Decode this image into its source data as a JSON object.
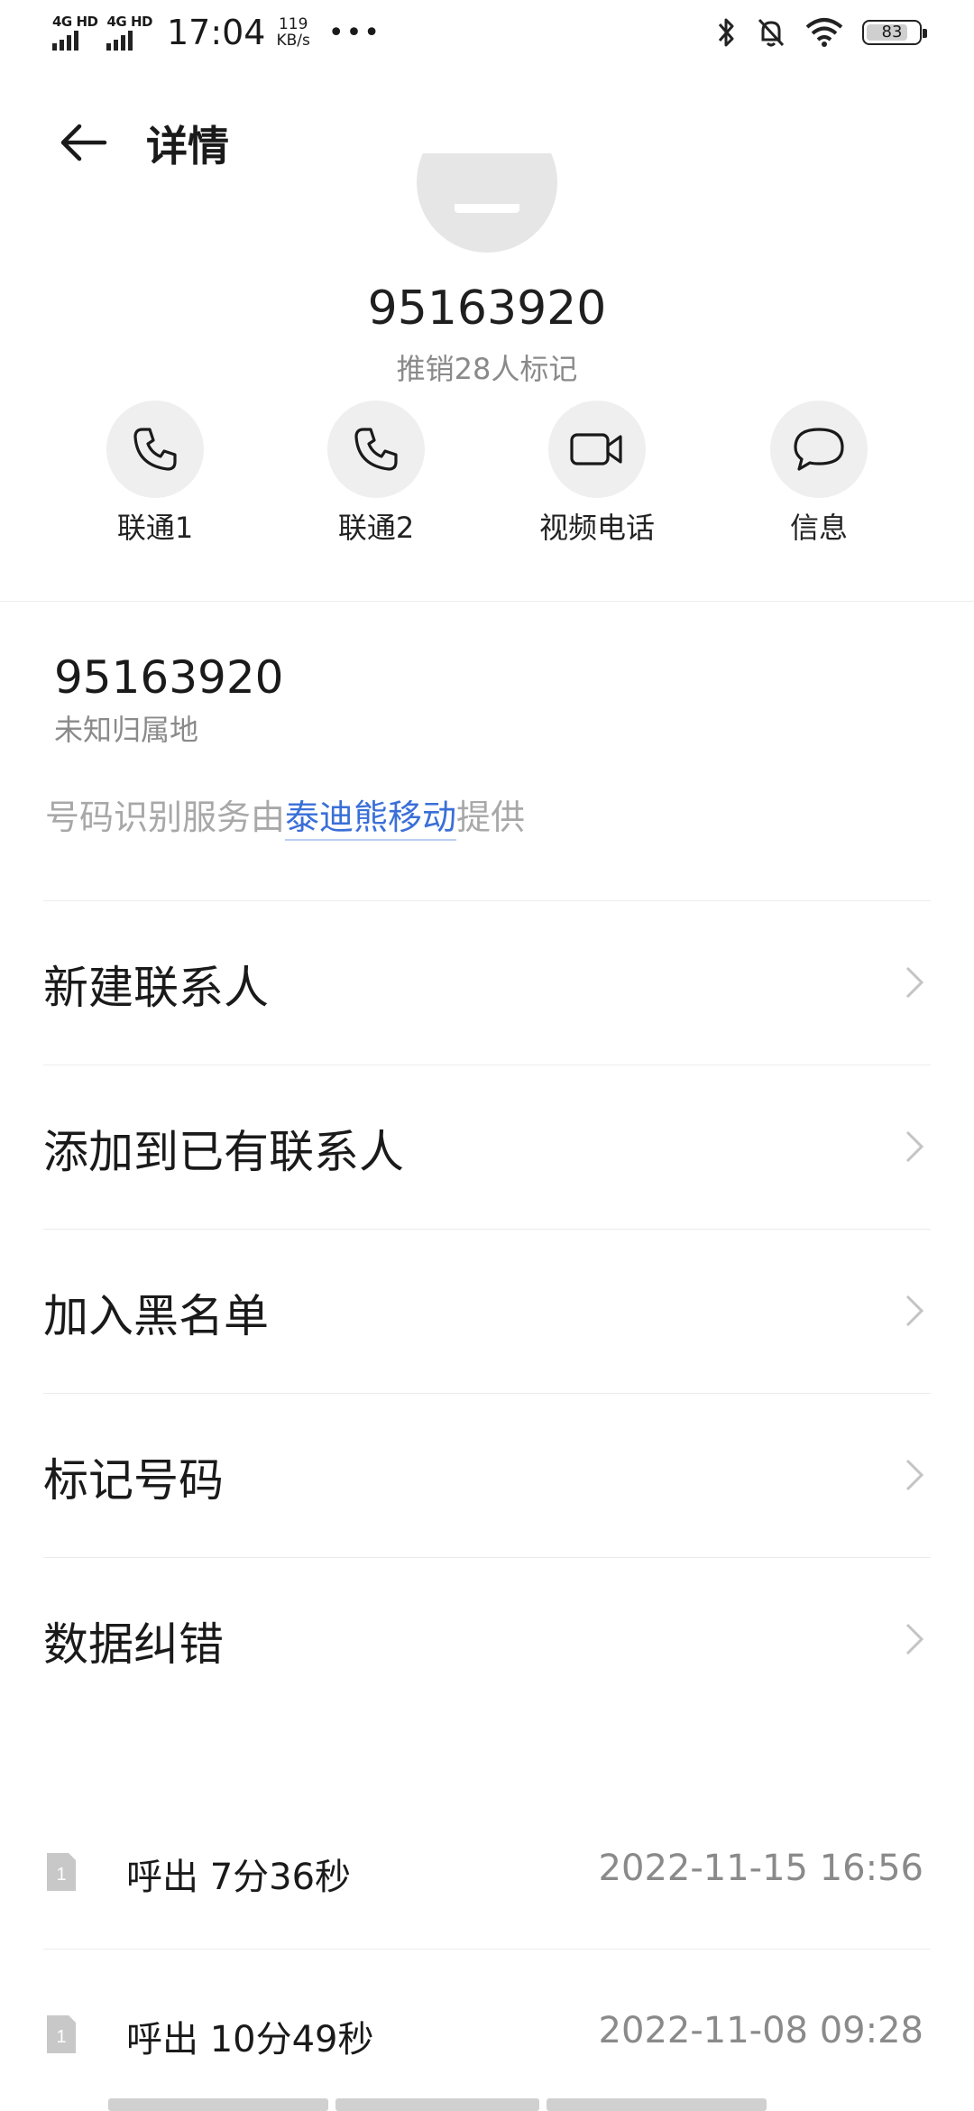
{
  "status_bar": {
    "signal1": "4G HD",
    "signal2": "4G HD",
    "time": "17:04",
    "speed_value": "119",
    "speed_unit": "KB/s",
    "more": "•••",
    "battery": "83",
    "battery_level_percent": 83,
    "icons": [
      "bluetooth-icon",
      "bell-off-icon",
      "wifi-icon",
      "battery-icon"
    ]
  },
  "topbar": {
    "title": "详情",
    "back_icon": "arrow-left-icon"
  },
  "header": {
    "number": "95163920",
    "tag": "推销28人标记"
  },
  "actions": [
    {
      "label": "联通1",
      "icon": "phone-icon"
    },
    {
      "label": "联通2",
      "icon": "phone-icon"
    },
    {
      "label": "视频电话",
      "icon": "video-camera-icon"
    },
    {
      "label": "信息",
      "icon": "chat-bubble-icon"
    }
  ],
  "info": {
    "number": "95163920",
    "location": "未知归属地",
    "provider_prefix": "号码识别服务由",
    "provider_link": "泰迪熊移动",
    "provider_suffix": "提供"
  },
  "menu": [
    {
      "label": "新建联系人"
    },
    {
      "label": "添加到已有联系人"
    },
    {
      "label": "加入黑名单"
    },
    {
      "label": "标记号码"
    },
    {
      "label": "数据纠错"
    }
  ],
  "calls": [
    {
      "sim": "1",
      "desc": "呼出 7分36秒",
      "time": "2022-11-15 16:56"
    },
    {
      "sim": "1",
      "desc": "呼出 10分49秒",
      "time": "2022-11-08 09:28"
    }
  ],
  "colors": {
    "link": "#3a6fd8",
    "secondary_text": "#8a8a8a",
    "circle_bg": "#efefef"
  }
}
